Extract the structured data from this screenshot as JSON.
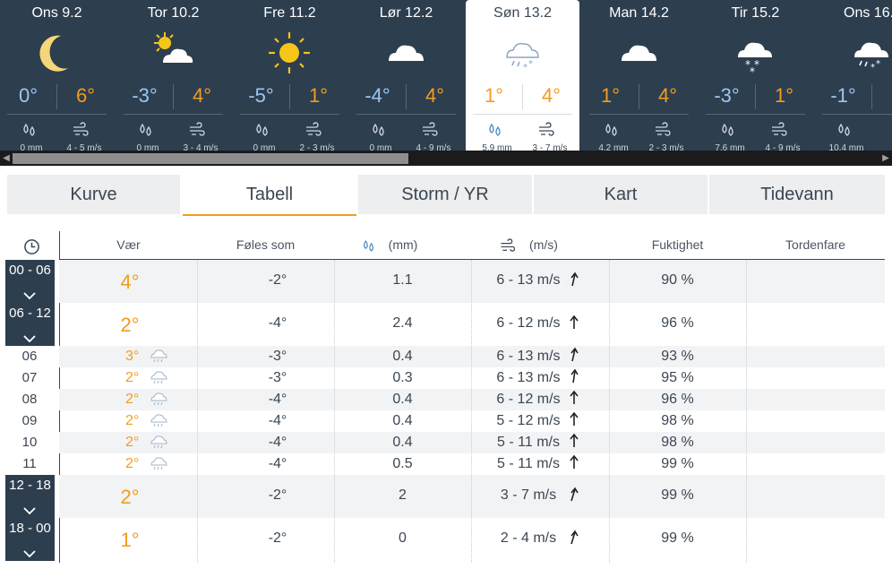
{
  "days": [
    {
      "label": "Ons 9.2",
      "icon": "moon-icon",
      "lo": "0°",
      "hi": "6°",
      "precip": "0 mm",
      "wind": "4 - 5 m/s"
    },
    {
      "label": "Tor 10.2",
      "icon": "partly-cloudy-icon",
      "lo": "-3°",
      "hi": "4°",
      "precip": "0 mm",
      "wind": "3 - 4 m/s"
    },
    {
      "label": "Fre 11.2",
      "icon": "sun-icon",
      "lo": "-5°",
      "hi": "1°",
      "precip": "0 mm",
      "wind": "2 - 3 m/s"
    },
    {
      "label": "Lør 12.2",
      "icon": "cloud-icon",
      "lo": "-4°",
      "hi": "4°",
      "precip": "0 mm",
      "wind": "4 - 9 m/s"
    },
    {
      "label": "Søn 13.2",
      "icon": "sleet-icon",
      "lo": "1°",
      "hi": "4°",
      "precip": "5.9 mm",
      "wind": "3 - 7 m/s"
    },
    {
      "label": "Man 14.2",
      "icon": "cloud-icon",
      "lo": "1°",
      "hi": "4°",
      "precip": "4.2 mm",
      "wind": "2 - 3 m/s"
    },
    {
      "label": "Tir 15.2",
      "icon": "snow-icon",
      "lo": "-3°",
      "hi": "1°",
      "precip": "7.6 mm",
      "wind": "4 - 9 m/s"
    },
    {
      "label": "Ons 16.",
      "icon": "sleet-icon",
      "lo": "-1°",
      "hi": "",
      "precip": "10.4 mm",
      "wind": ""
    }
  ],
  "selected_day": 4,
  "tabs": [
    "Kurve",
    "Tabell",
    "Storm / YR",
    "Kart",
    "Tidevann"
  ],
  "active_tab": 1,
  "table": {
    "headers": {
      "weather": "Vær",
      "feels": "Føles som",
      "precip": "(mm)",
      "wind": "(m/s)",
      "humidity": "Fuktighet",
      "thunder": "Tordenfare"
    },
    "rows": [
      {
        "kind": "period",
        "time": "00 - 06",
        "temp": "4°",
        "feels": "-2°",
        "precip": "1.1",
        "wind": "6 - 13 m/s",
        "humidity": "90 %",
        "thunder": ""
      },
      {
        "kind": "period",
        "time": "06 - 12",
        "temp": "2°",
        "feels": "-4°",
        "precip": "2.4",
        "wind": "6 - 12 m/s",
        "humidity": "96 %",
        "thunder": ""
      },
      {
        "kind": "hour",
        "time": "06",
        "temp": "3°",
        "feels": "-3°",
        "precip": "0.4",
        "wind": "6 - 13 m/s",
        "humidity": "93 %",
        "thunder": ""
      },
      {
        "kind": "hour",
        "time": "07",
        "temp": "2°",
        "feels": "-3°",
        "precip": "0.3",
        "wind": "6 - 13 m/s",
        "humidity": "95 %",
        "thunder": ""
      },
      {
        "kind": "hour",
        "time": "08",
        "temp": "2°",
        "feels": "-4°",
        "precip": "0.4",
        "wind": "6 - 12 m/s",
        "humidity": "96 %",
        "thunder": ""
      },
      {
        "kind": "hour",
        "time": "09",
        "temp": "2°",
        "feels": "-4°",
        "precip": "0.4",
        "wind": "5 - 12 m/s",
        "humidity": "98 %",
        "thunder": ""
      },
      {
        "kind": "hour",
        "time": "10",
        "temp": "2°",
        "feels": "-4°",
        "precip": "0.4",
        "wind": "5 - 11 m/s",
        "humidity": "98 %",
        "thunder": ""
      },
      {
        "kind": "hour",
        "time": "11",
        "temp": "2°",
        "feels": "-4°",
        "precip": "0.5",
        "wind": "5 - 11 m/s",
        "humidity": "99 %",
        "thunder": ""
      },
      {
        "kind": "period",
        "time": "12 - 18",
        "temp": "2°",
        "feels": "-2°",
        "precip": "2",
        "wind": "3 - 7 m/s",
        "humidity": "99 %",
        "thunder": ""
      },
      {
        "kind": "period",
        "time": "18 - 00",
        "temp": "1°",
        "feels": "-2°",
        "precip": "0",
        "wind": "2 - 4 m/s",
        "humidity": "99 %",
        "thunder": ""
      }
    ]
  },
  "colors": {
    "accent": "#f39c1f",
    "header_bg": "#2d3e4f",
    "cold": "#9cc7f0"
  }
}
